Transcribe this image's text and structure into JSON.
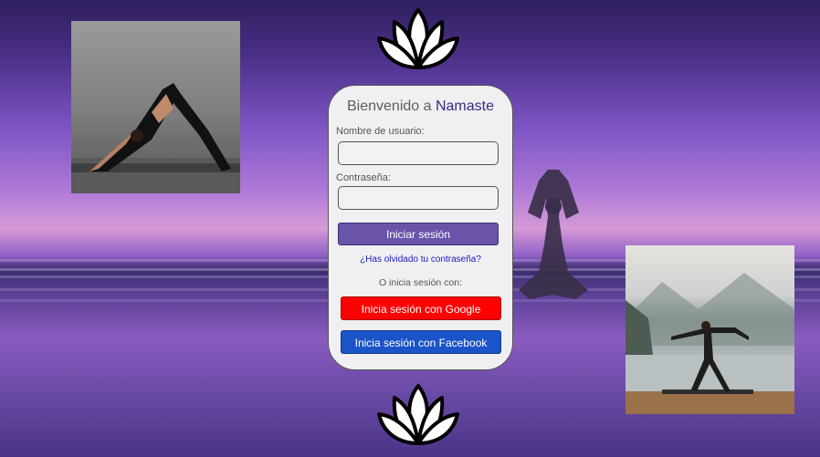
{
  "login_card": {
    "title_prefix": "Bienvenido a ",
    "title_brand": "Namaste",
    "username_label": "Nombre de usuario:",
    "username_value": "",
    "password_label": "Contraseña:",
    "password_value": "",
    "login_button": "Iniciar sesión",
    "forgot_link": "¿Has olvidado tu contraseña?",
    "or_text": "O inicia sesión con:",
    "google_button": "Inicia sesión con Google",
    "facebook_button": "Inicia sesión con Facebook"
  },
  "colors": {
    "brand": "#3b2a86",
    "login_button": "#6a54a9",
    "google": "#ff0000",
    "facebook": "#1a54c8",
    "link": "#1b1bbd"
  },
  "icons": [
    "lotus-icon"
  ]
}
